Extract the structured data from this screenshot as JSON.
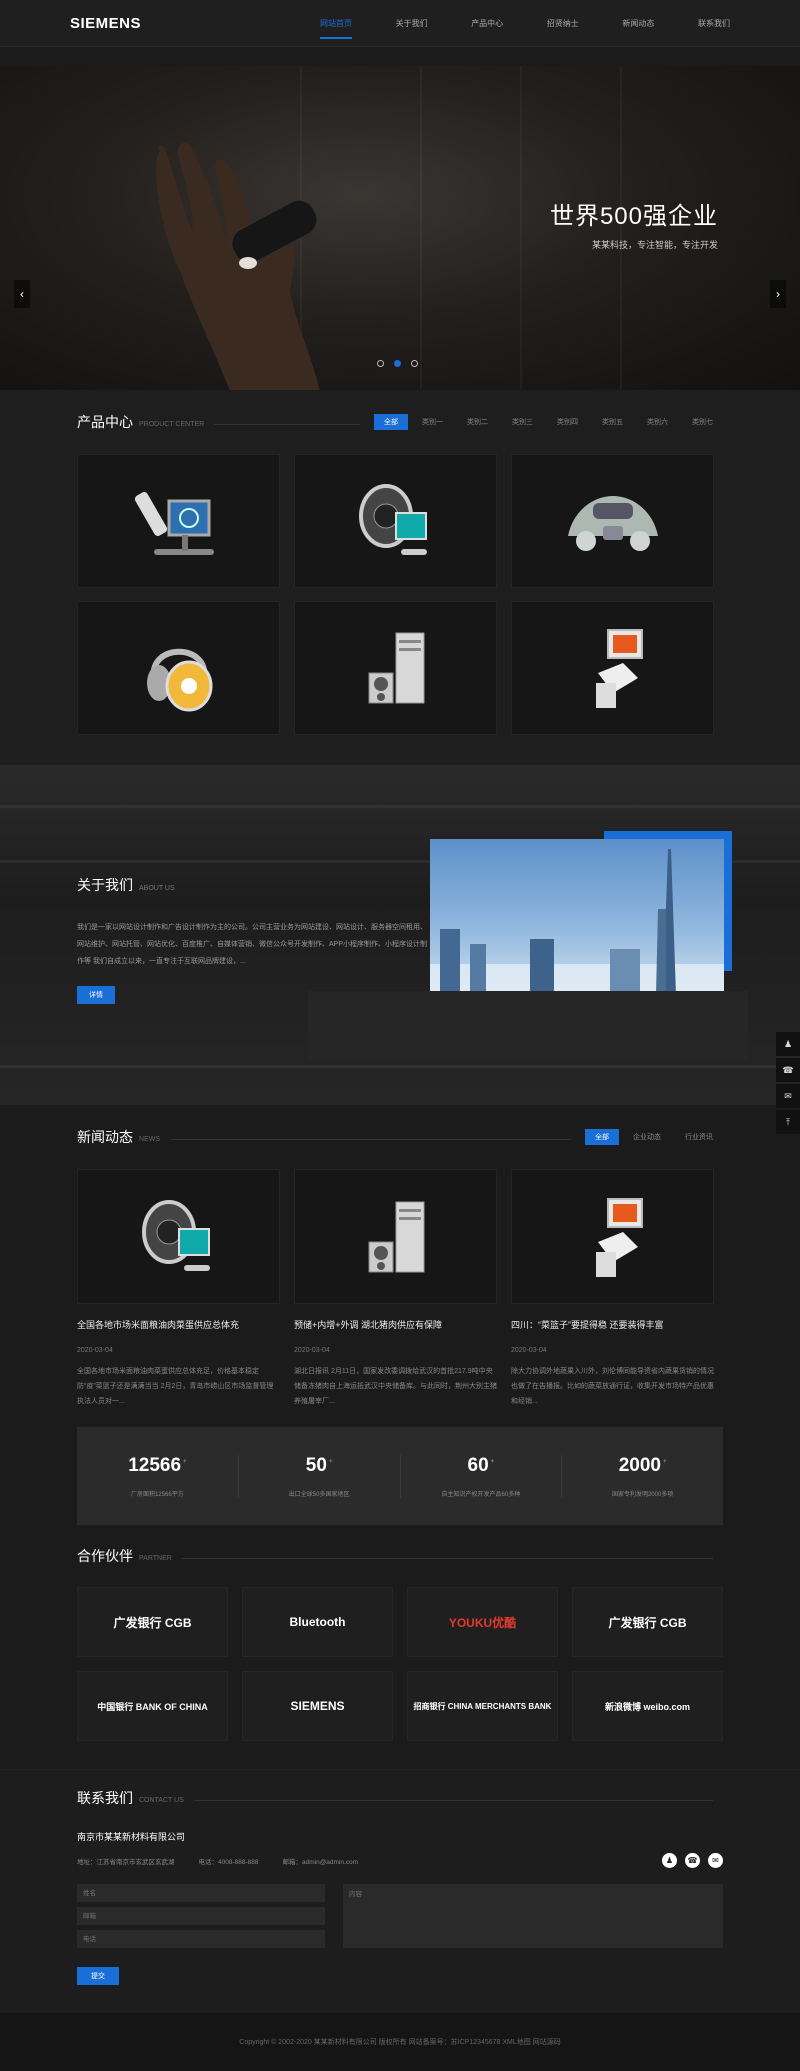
{
  "header": {
    "logo": "SIEMENS",
    "nav": [
      "网站首页",
      "关于我们",
      "产品中心",
      "招贤纳士",
      "新闻动态",
      "联系我们"
    ]
  },
  "banner": {
    "title": "世界500强企业",
    "subtitle": "某某科技，专注智能，专注开发",
    "prev": "‹",
    "next": "›"
  },
  "products": {
    "title": "产品中心",
    "title_en": "PRODUCT CENTER",
    "tabs": [
      "全部",
      "类别一",
      "类别二",
      "类别三",
      "类别四",
      "类别五",
      "类别六",
      "类别七"
    ]
  },
  "about": {
    "title": "关于我们",
    "title_en": "ABOUT US",
    "text": "我们是一家以网站设计制作和广告设计制作为主的公司。公司主营业务为网站建设、网站设计、服务器空间租用、网站维护、网站托管、网站优化、百度推广、自媒体营销、微信公众号开发制作、APP小程序制作、小程序设计制作等 我们自成立以来，一直专注于互联网品牌建设，...",
    "button": "详情"
  },
  "news": {
    "title": "新闻动态",
    "title_en": "NEWS",
    "tabs": [
      "全部",
      "企业动态",
      "行业资讯"
    ],
    "items": [
      {
        "title": "全国各地市场米面粮油肉菜蛋供应总体充",
        "date": "2020-03-04",
        "summary": "全国各地市场米面粮油肉菜蛋供应总体充足，价格基本稳定 防“疫”菜篮子还是满满当当 2月2日，青岛市崂山区市场监督管理执法人员对一..."
      },
      {
        "title": "预储+内增+外调 湖北猪肉供应有保障",
        "date": "2020-03-04",
        "summary": "湖北日报讯 2月11日，国家发改委调拨给武汉的首批217.9吨中央储备冻猪肉自上海运抵武汉中央储备库。与此同时，荆州大别主猪养殖屠宰厂..."
      },
      {
        "title": "四川：“菜篮子”要提得稳 还要装得丰富",
        "date": "2020-03-04",
        "summary": "除大力协调外地蔬果入川外，刘伦博同能导资省内蔬果货销的情况也做了在告播报。比如的蔬菜放通行证，收集开发市场特产品优惠和经销..."
      }
    ]
  },
  "stats": [
    {
      "num": "12566",
      "sup": "+",
      "label": "厂房面积12566平方"
    },
    {
      "num": "50",
      "sup": "+",
      "label": "出口全球50多国家地区"
    },
    {
      "num": "60",
      "sup": "+",
      "label": "自主知识产权开发产品60多种"
    },
    {
      "num": "2000",
      "sup": "+",
      "label": "国家专利发明2000多项"
    }
  ],
  "partners": {
    "title": "合作伙伴",
    "title_en": "PARTNER",
    "logos": [
      "广发银行 CGB",
      "Bluetooth",
      "YOUKU优酷",
      "广发银行 CGB",
      "中国银行 BANK OF CHINA",
      "SIEMENS",
      "招商银行 CHINA MERCHANTS BANK",
      "新浪微博 weibo.com"
    ]
  },
  "contact": {
    "title": "联系我们",
    "title_en": "CONTACT US",
    "company": "南京市某某新材料有限公司",
    "address": "地址：江苏省南京市玄武区玄武湖",
    "phone": "电话：4008-888-888",
    "email": "邮箱：admin@admin.com",
    "placeholders": {
      "name": "姓名",
      "email": "邮箱",
      "phone": "电话",
      "content": "内容"
    },
    "submit": "提交"
  },
  "footer": "Copyright © 2002-2020 某某新材料有限公司 版权所有 网站备案号：苏ICP12345678 XML地图 网站源码",
  "colors": {
    "accent": "#1a6ed8",
    "bg": "#1b1b1c"
  }
}
